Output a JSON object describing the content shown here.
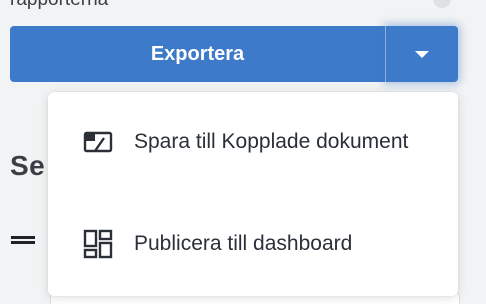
{
  "header": {
    "label": "rapporterna"
  },
  "export": {
    "button_label": "Exportera",
    "toggle_icon": "caret-down-icon"
  },
  "section": {
    "heading": "Se"
  },
  "menu": {
    "items": [
      {
        "label": "Spara till Kopplade dokument",
        "icon": "linked-documents-icon"
      },
      {
        "label": "Publicera till dashboard",
        "icon": "dashboard-icon"
      }
    ]
  },
  "colors": {
    "accent": "#3d7ac9",
    "text": "#2b3038",
    "background": "#f2f3f4"
  }
}
